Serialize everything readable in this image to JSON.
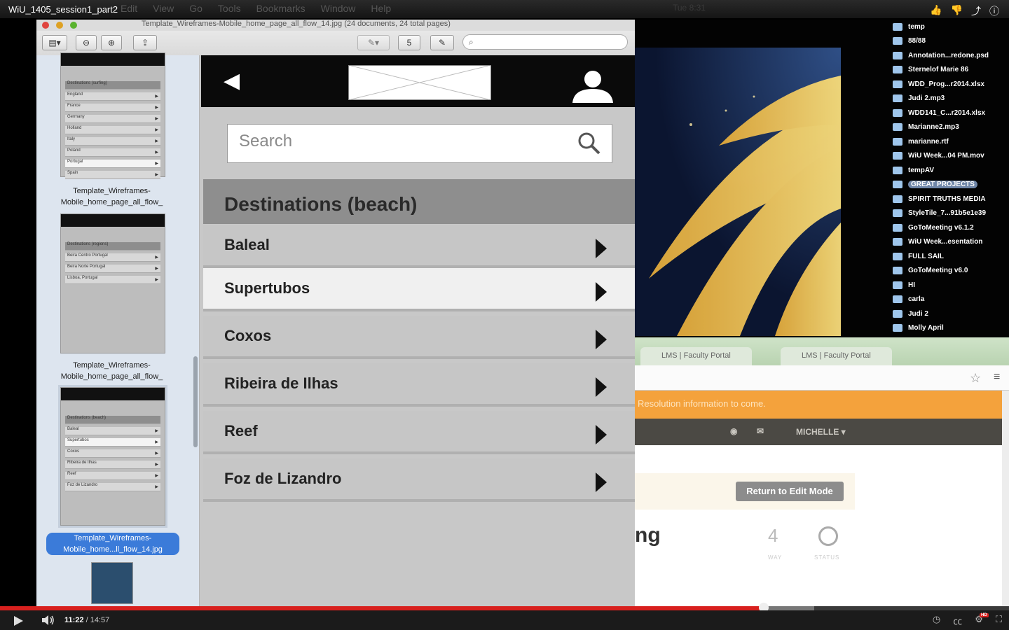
{
  "video": {
    "title": "WiU_1405_session1_part2",
    "time_current": "11:22",
    "time_sep": " / ",
    "time_total": "14:57",
    "progress_played": 0.757,
    "progress_loaded": 0.807
  },
  "menubar": {
    "items": [
      "Edit",
      "View",
      "Go",
      "Tools",
      "Bookmarks",
      "Window",
      "Help"
    ],
    "clock": "Tue 8:31"
  },
  "preview": {
    "title": "Template_Wireframes-Mobile_home_page_all_flow_14.jpg (24 documents, 24 total pages)",
    "page_field": "5",
    "thumbnails": [
      {
        "caption": "Template_Wireframes-Mobile_home_page_all_flow_",
        "section": "Destinations (surfing)",
        "rows": [
          "England",
          "France",
          "Germany",
          "Holland",
          "Italy",
          "Poland",
          "Portugal",
          "Spain"
        ]
      },
      {
        "caption": "Template_Wireframes-Mobile_home_page_all_flow_",
        "section": "Destinations (regions)",
        "rows": [
          "Beira Centro Portugal",
          "Beira Norte Portugal",
          "Lisboa, Portugal"
        ]
      },
      {
        "caption": "Template_Wireframes-Mobile_home...ll_flow_14.jpg",
        "section": "Destinations (beach)",
        "rows": [
          "Baleal",
          "Supertubos",
          "Coxos",
          "Ribeira de Ilhas",
          "Reef",
          "Foz de Lizandro"
        ]
      }
    ]
  },
  "wireframe": {
    "search_placeholder": "Search",
    "section_title": "Destinations (beach)",
    "items": [
      "Baleal",
      "Supertubos",
      "Coxos",
      "Ribeira de Ilhas",
      "Reef",
      "Foz de Lizandro"
    ],
    "selected_index": 1
  },
  "desktop_files": [
    "temp",
    "88/88",
    "Annotation...redone.psd",
    "Sternelof Marie 86",
    "WDD_Prog...r2014.xlsx",
    "Judi 2.mp3",
    "WDD141_C...r2014.xlsx",
    "Marianne2.mp3",
    "marianne.rtf",
    "WiU Week...04 PM.mov",
    "tempAV",
    "GREAT PROJECTS",
    "SPIRIT TRUTHS MEDIA",
    "StyleTile_7...91b5e1e39",
    "GoToMeeting v6.1.2",
    "WiU Week...esentation",
    "FULL SAIL",
    "GoToMeeting v6.0",
    "HI",
    "carla",
    "Judi 2",
    "Molly April"
  ],
  "browser": {
    "tabs": [
      "LMS | Faculty Portal",
      "LMS | Faculty Portal"
    ],
    "banner": "Resolution information to come.",
    "user_menu": "MICHELLE ▾",
    "edit_button": "Return to Edit Mode",
    "heading_fragment": "ng",
    "stat_value": "4",
    "stat_value_label": "WAY",
    "stat_status_label": "STATUS"
  },
  "colors": {
    "progress_red": "#d8201e",
    "selection_blue": "#3b7bd9",
    "banner_orange": "#f4a23c"
  }
}
